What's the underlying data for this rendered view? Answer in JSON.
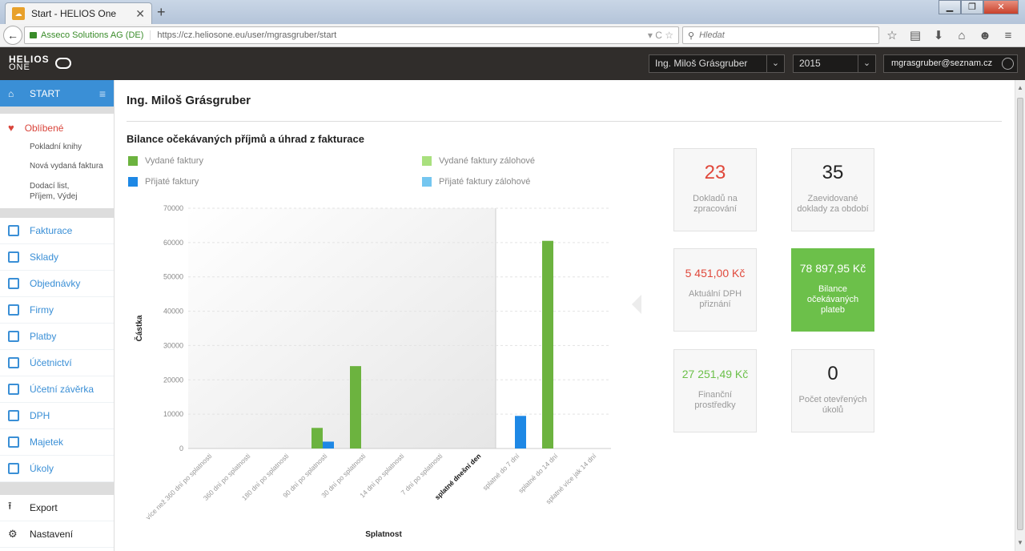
{
  "browser": {
    "tab_title": "Start - HELIOS One",
    "new_tab": "+",
    "identity": "Asseco Solutions AG (DE)",
    "url": "https://cz.heliosone.eu/user/mgrasgruber/start",
    "search_placeholder": "Hledat"
  },
  "header": {
    "logo_top": "HELIOS",
    "logo_bottom": "ONE",
    "user_select": "Ing. Miloš Grásgruber",
    "year_select": "2015",
    "email": "mgrasgruber@seznam.cz"
  },
  "sidebar": {
    "start": "START",
    "favorites": "Oblíbené",
    "fav_items": [
      "Pokladní knihy",
      "Nová vydaná faktura",
      "Dodací list, Příjem, Výdej"
    ],
    "items": [
      "Fakturace",
      "Sklady",
      "Objednávky",
      "Firmy",
      "Platby",
      "Účetnictví",
      "Účetní závěrka",
      "DPH",
      "Majetek",
      "Úkoly"
    ],
    "export": "Export",
    "settings": "Nastavení"
  },
  "main": {
    "title": "Ing. Miloš Grásgruber",
    "section_title": "Bilance očekávaných příjmů a úhrad z fakturace"
  },
  "legend": [
    {
      "label": "Vydané faktury",
      "color": "#6cb33f"
    },
    {
      "label": "Vydané faktury zálohové",
      "color": "#a9e07e"
    },
    {
      "label": "Přijaté faktury",
      "color": "#1e88e5"
    },
    {
      "label": "Přijaté faktury zálohové",
      "color": "#74c6f0"
    }
  ],
  "chart_data": {
    "type": "bar",
    "xlabel": "Splatnost",
    "ylabel": "Částka",
    "ylim": [
      0,
      70000
    ],
    "yticks": [
      0,
      10000,
      20000,
      30000,
      40000,
      50000,
      60000,
      70000
    ],
    "highlight_category": "splatné dnešní den",
    "categories": [
      "více než 360 dní po splatnosti",
      "360 dní po splatnosti",
      "180 dní po splatnosti",
      "90 dní po splatnosti",
      "30 dní po splatnosti",
      "14 dní po splatnosti",
      "7 dní po splatnosti",
      "splatné dnešní den",
      "splatné do 7 dní",
      "splatné do 14 dní",
      "splatné více jak 14 dní"
    ],
    "series": [
      {
        "name": "Vydané faktury",
        "color": "#6cb33f",
        "values": [
          0,
          0,
          0,
          6000,
          24000,
          0,
          0,
          0,
          0,
          60500,
          0
        ]
      },
      {
        "name": "Přijaté faktury",
        "color": "#1e88e5",
        "values": [
          0,
          0,
          0,
          2000,
          0,
          0,
          0,
          0,
          9500,
          0,
          0
        ]
      }
    ]
  },
  "tiles": [
    {
      "value": "23",
      "label": "Dokladů na zpracování",
      "color": "#e0483b"
    },
    {
      "value": "35",
      "label": "Zaevidované doklady za období",
      "color": "#222222"
    },
    {
      "value": "5 451,00 Kč",
      "label": "Aktuální DPH přiznání",
      "color": "#e0483b"
    },
    {
      "value": "78 897,95 Kč",
      "label": "Bilance očekávaných plateb",
      "color": "#ffffff"
    },
    {
      "value": "27 251,49 Kč",
      "label": "Finanční prostředky",
      "color": "#6cc04a"
    },
    {
      "value": "0",
      "label": "Počet otevřených úkolů",
      "color": "#222222"
    }
  ]
}
